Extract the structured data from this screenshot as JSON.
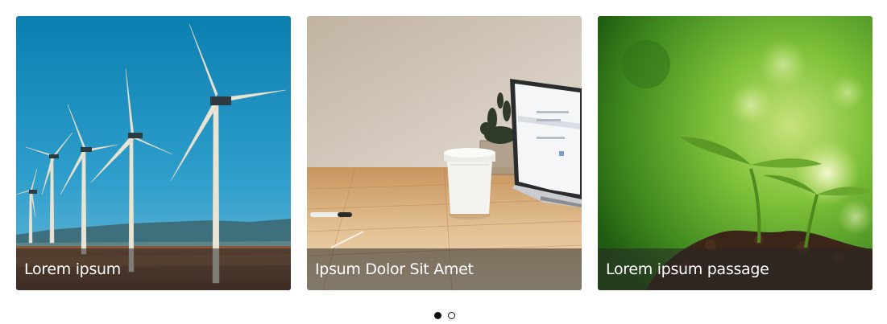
{
  "slides": [
    {
      "caption": "Lorem ipsum",
      "image": "wind-turbines-photo"
    },
    {
      "caption": "Ipsum Dolor Sit Amet",
      "image": "desk-laptop-coffee-photo"
    },
    {
      "caption": "Lorem ipsum passage",
      "image": "seedling-soil-photo"
    }
  ],
  "pagination": {
    "pages": 2,
    "active_index": 0
  },
  "colors": {
    "caption_overlay": "#282828",
    "caption_text": "#ffffff",
    "dot": "#111111"
  }
}
